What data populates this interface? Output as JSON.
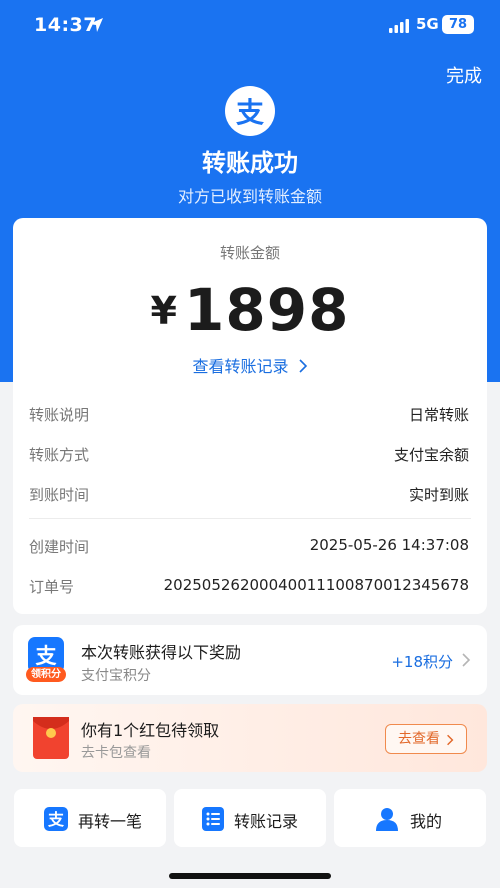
{
  "status_bar": {
    "time": "14:37",
    "network": "5G",
    "battery": "78"
  },
  "header": {
    "done_label": "完成",
    "logo_glyph": "支",
    "title": "转账成功",
    "subtitle": "对方已收到转账金额"
  },
  "transfer": {
    "amount_label": "转账金额",
    "currency": "¥",
    "amount": "1898",
    "record_link": "查看转账记录"
  },
  "details": [
    {
      "label": "转账说明",
      "value": "日常转账"
    },
    {
      "label": "转账方式",
      "value": "支付宝余额"
    },
    {
      "label": "到账时间",
      "value": "实时到账"
    },
    {
      "label": "创建时间",
      "value": "2025-05-26 14:37:08"
    },
    {
      "label": "订单号",
      "value": "2025052620004001110087001234567​8"
    }
  ],
  "reward": {
    "icon_glyph": "支",
    "icon_tag": "领积分",
    "title": "本次转账获得以下奖励",
    "subtitle": "支付宝积分",
    "points": "+18积分"
  },
  "red_packet": {
    "title": "你有1个红包待领取",
    "subtitle": "去卡包查看",
    "button": "去查看"
  },
  "bottom_actions": [
    {
      "label": "再转一笔",
      "icon": "alipay-icon"
    },
    {
      "label": "转账记录",
      "icon": "list-icon"
    },
    {
      "label": "我的",
      "icon": "person-icon"
    }
  ],
  "colors": {
    "brand_blue": "#1a73f1",
    "link_blue": "#1a6ee0",
    "accent_orange": "#ff5a1f"
  }
}
